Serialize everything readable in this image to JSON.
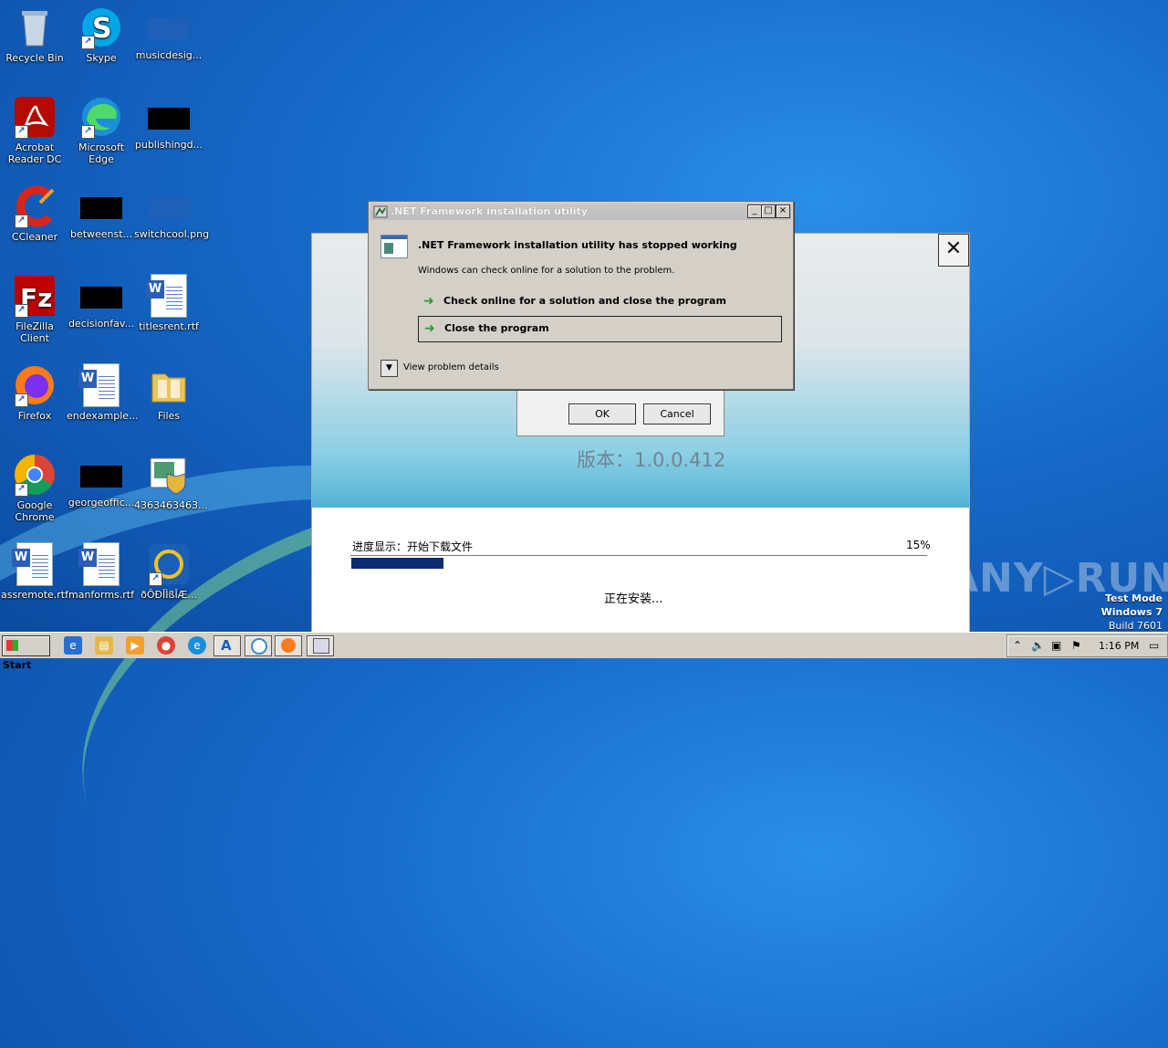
{
  "desktop": {
    "icons": [
      {
        "label": "Recycle Bin"
      },
      {
        "label": "Skype"
      },
      {
        "label": "musicdesig..."
      },
      {
        "label": "Acrobat Reader DC"
      },
      {
        "label": "Microsoft Edge"
      },
      {
        "label": "publishingd..."
      },
      {
        "label": "CCleaner"
      },
      {
        "label": "betweenst..."
      },
      {
        "label": "switchcool.png"
      },
      {
        "label": "FileZilla Client"
      },
      {
        "label": "decisionfav..."
      },
      {
        "label": "titlesrent.rtf"
      },
      {
        "label": "Firefox"
      },
      {
        "label": "endexample..."
      },
      {
        "label": "Files"
      },
      {
        "label": "Google Chrome"
      },
      {
        "label": "georgeoffic..."
      },
      {
        "label": "4363463463..."
      },
      {
        "label": "assremote.rtf"
      },
      {
        "label": "manforms.rtf"
      },
      {
        "label": "ðÕÐÎÌßÎÆ..."
      }
    ]
  },
  "installer": {
    "version": "版本：1.0.0.412",
    "progress_label": "进度显示：开始下载文件",
    "progress_percent": "15%",
    "progress_value": 0.16,
    "status": "正在安装...",
    "close_glyph": "✕"
  },
  "message_box": {
    "ok_label": "OK",
    "cancel_label": "Cancel"
  },
  "error_dialog": {
    "title": ".NET Framework installation utility",
    "headline": ".NET Framework installation utility has stopped working",
    "subtext": "Windows can check online for a solution to the problem.",
    "option_check": "Check online for a solution and close the program",
    "option_close": "Close the program",
    "details": "View problem details"
  },
  "watermark": {
    "text": "ANY▷RUN",
    "line1": "Test Mode",
    "line2": "Windows 7",
    "line3": "Build 7601"
  },
  "taskbar": {
    "start_label": "Start",
    "clock": "1:16 PM"
  }
}
